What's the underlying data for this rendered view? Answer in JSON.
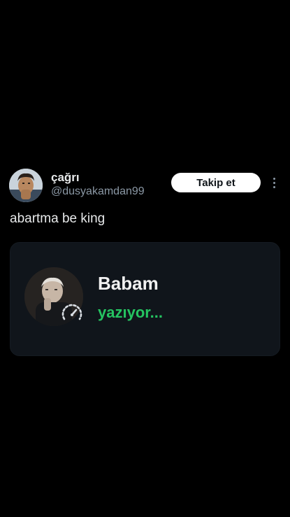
{
  "tweet": {
    "display_name": "çağrı",
    "handle": "@dusyakamdan99",
    "follow_label": "Takip et",
    "text": "abartma be king",
    "avatar_icon": "user-avatar-icon",
    "more_icon": "more-options-icon"
  },
  "embedded_chat": {
    "contact_name": "Babam",
    "status": "yazıyor...",
    "status_color": "#25c461",
    "photo_icon": "contact-photo-icon",
    "badge_icon": "speedometer-icon"
  },
  "colors": {
    "background": "#000000",
    "card_background": "#10151b",
    "primary_text": "#e7e9ea",
    "secondary_text": "#8b98a5",
    "button_background": "#ffffff"
  }
}
